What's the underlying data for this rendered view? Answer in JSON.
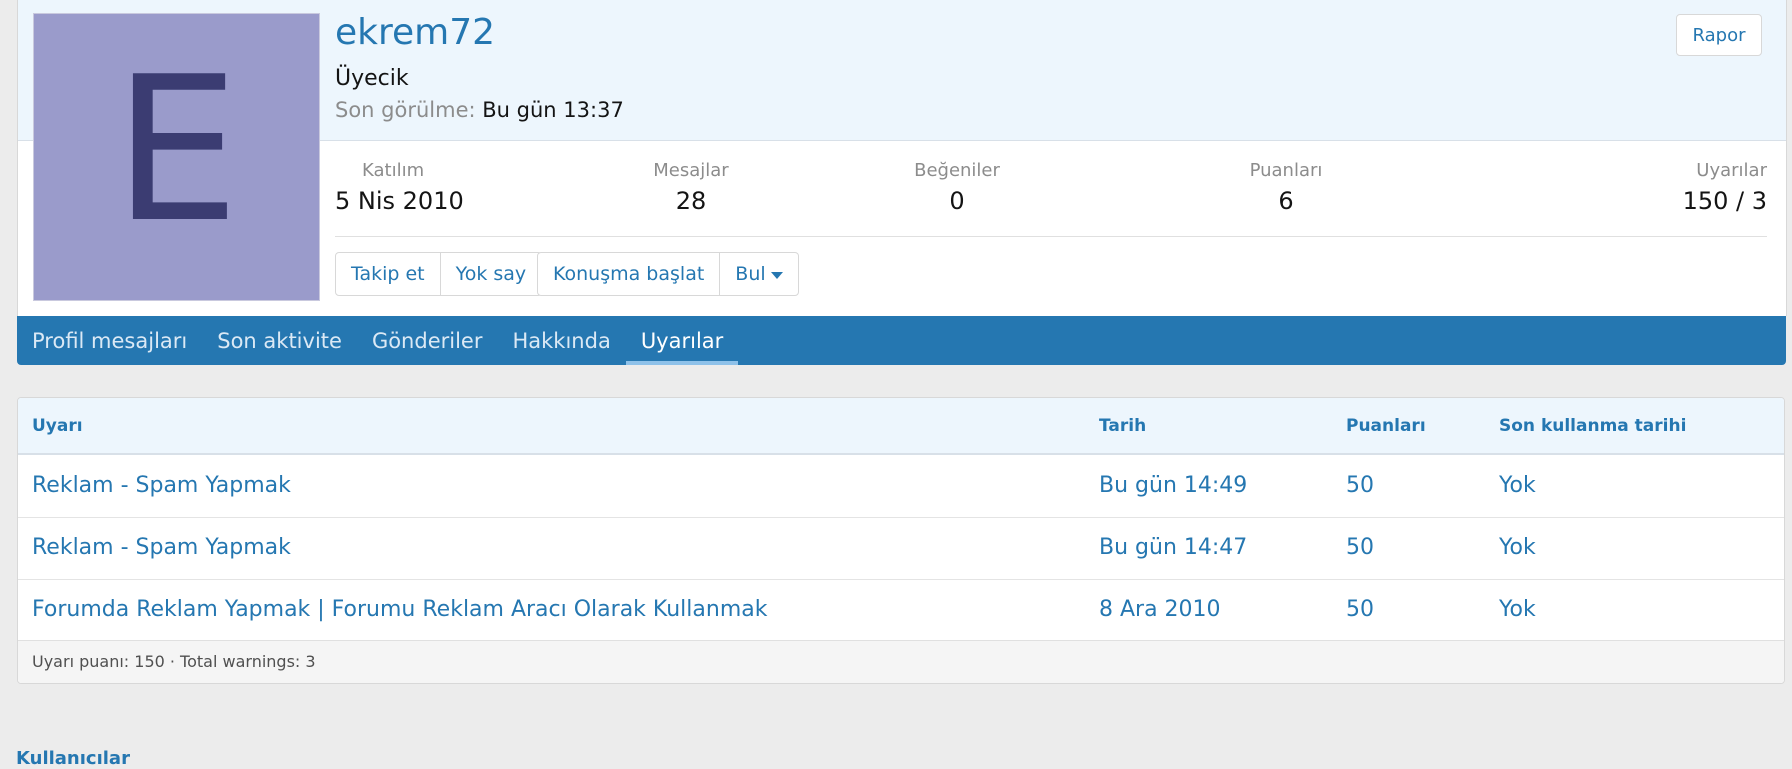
{
  "profile": {
    "avatar_letter": "E",
    "username": "ekrem72",
    "user_title": "Üyecik",
    "last_seen_label": "Son görülme:",
    "last_seen_value": "Bu gün 13:37",
    "report_label": "Rapor",
    "avatar_color": "#9a9bcb",
    "avatar_letter_color": "#3b3c72"
  },
  "stats": [
    {
      "label": "Katılım",
      "value": "5 Nis 2010"
    },
    {
      "label": "Mesajlar",
      "value": "28"
    },
    {
      "label": "Beğeniler",
      "value": "0"
    },
    {
      "label": "Puanları",
      "value": "6"
    },
    {
      "label": "Uyarılar",
      "value": "150 / 3"
    }
  ],
  "actions": {
    "follow": "Takip et",
    "ignore": "Yok say",
    "start_conversation": "Konuşma başlat",
    "find": "Bul"
  },
  "tabs": [
    {
      "label": "Profil mesajları"
    },
    {
      "label": "Son aktivite"
    },
    {
      "label": "Gönderiler"
    },
    {
      "label": "Hakkında"
    },
    {
      "label": "Uyarılar",
      "active": true
    }
  ],
  "warnings": {
    "headers": {
      "warning": "Uyarı",
      "date": "Tarih",
      "points": "Puanları",
      "expiry": "Son kullanma tarihi"
    },
    "rows": [
      {
        "title": "Reklam - Spam Yapmak",
        "date": "Bu gün 14:49",
        "points": "50",
        "expiry": "Yok"
      },
      {
        "title": "Reklam - Spam Yapmak",
        "date": "Bu gün 14:47",
        "points": "50",
        "expiry": "Yok"
      },
      {
        "title": "Forumda Reklam Yapmak | Forumu Reklam Aracı Olarak Kullanmak",
        "date": "8 Ara 2010",
        "points": "50",
        "expiry": "Yok"
      }
    ],
    "footer": "Uyarı puanı: 150 · Total warnings: 3"
  },
  "breadcrumb": "Kullanıcılar",
  "colors": {
    "accent": "#2577b1",
    "header_bg": "#edf6fd",
    "page_bg": "#ececec"
  }
}
